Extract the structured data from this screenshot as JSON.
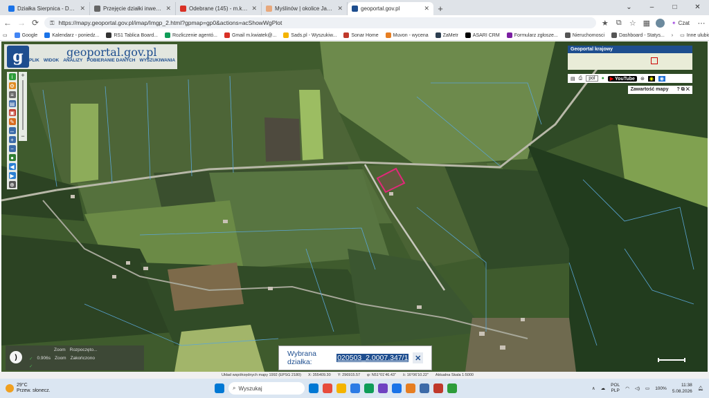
{
  "browser": {
    "tabs": [
      {
        "title": "Działka Sierpnica - Dysk Google",
        "color": "#1a73e8",
        "active": false
      },
      {
        "title": "Przejęcie działki inwestycyjnej",
        "color": "#666666",
        "active": false
      },
      {
        "title": "Odebrane (145) - m.kwiatek@mu",
        "color": "#d93025",
        "active": false
      },
      {
        "title": "Myślinów | okolice Jawora - Muvo",
        "color": "#e8a87c",
        "active": false
      },
      {
        "title": "geoportal.gov.pl",
        "color": "#1e4e8f",
        "active": true
      }
    ],
    "new_tab": "+",
    "window_controls": [
      "⌄",
      "–",
      "□",
      "✕"
    ],
    "url": "https://mapy.geoportal.gov.pl/imap/Imgp_2.html?gpmap=gp0&actions=acShowWgPlot",
    "chat_label": "Czat",
    "bookmarks": [
      {
        "label": "Google",
        "color": "#4285f4"
      },
      {
        "label": "Kalendarz - poniedz...",
        "color": "#1a73e8"
      },
      {
        "label": "RS1 Tablica Board...",
        "color": "#333333"
      },
      {
        "label": "Rozliczenie agentó...",
        "color": "#0f9d58"
      },
      {
        "label": "Gmail m.kwiatek@...",
        "color": "#d93025"
      },
      {
        "label": "Sads.pl - Wyszukiw...",
        "color": "#f4b400"
      },
      {
        "label": "Sonar Home",
        "color": "#c0392b"
      },
      {
        "label": "Muvon - wycena",
        "color": "#e67e22"
      },
      {
        "label": "ZaMetr",
        "color": "#2c3e50"
      },
      {
        "label": "ASARI CRM",
        "color": "#000000"
      },
      {
        "label": "Formularz zgłosze...",
        "color": "#7b1fa2"
      },
      {
        "label": "Nieruchomosci",
        "color": "#555555"
      },
      {
        "label": "Dashboard - Statys...",
        "color": "#555555"
      }
    ],
    "bookmarks_more": "›",
    "other_bookmarks": "Inne ulubione"
  },
  "geoportal": {
    "logo_letter": "g",
    "site_name": "geoportal.gov.pl",
    "menu": [
      "PLIK",
      "WIDOK",
      "ANALIZY",
      "POBIERANIE DANYCH",
      "WYSZUKIWANIA"
    ],
    "tool_icons": [
      {
        "name": "info-icon",
        "glyph": "i",
        "color": "#2e9d3a"
      },
      {
        "name": "settings-icon",
        "glyph": "⚙",
        "color": "#e08a1e"
      },
      {
        "name": "layers-icon",
        "glyph": "≡",
        "color": "#6a6a6a"
      },
      {
        "name": "print-icon",
        "glyph": "▤",
        "color": "#3c6aa8"
      },
      {
        "name": "plot-icon",
        "glyph": "▣",
        "color": "#c0392b"
      },
      {
        "name": "draw-icon",
        "glyph": "✎",
        "color": "#d86a1e"
      },
      {
        "name": "measure-icon",
        "glyph": "↔",
        "color": "#3c6aa8"
      },
      {
        "name": "zoom-in-icon",
        "glyph": "+",
        "color": "#3c6aa8"
      },
      {
        "name": "zoom-out-icon",
        "glyph": "−",
        "color": "#3c6aa8"
      },
      {
        "name": "globe-icon",
        "glyph": "●",
        "color": "#2e7d32"
      },
      {
        "name": "back-arrow-icon",
        "glyph": "◀",
        "color": "#2a7fd4"
      },
      {
        "name": "forward-arrow-icon",
        "glyph": "▶",
        "color": "#2a7fd4"
      },
      {
        "name": "crosshair-icon",
        "glyph": "⊕",
        "color": "#555555"
      }
    ],
    "zoom_plus": "+",
    "zoom_minus": "−",
    "overview_title": "Geoportal krajowy",
    "lang_select": "pol",
    "youtube_label": "YouTube",
    "map_contents": "Zawartość mapy",
    "map_contents_controls": [
      "?",
      "⧉",
      "✕"
    ],
    "zoom_log": {
      "header": [
        "Zoom",
        "Rozpoczęto..."
      ],
      "row": [
        "0.906s",
        "Zoom",
        "Zakończono"
      ]
    },
    "selected_plot_label": "Wybrana działka:",
    "selected_plot_value": "020503_2.0007.347/1",
    "close": "✕",
    "status": {
      "crs": "Układ współrzędnych mapy 1992 (EPSG 2180)",
      "x": "X: 355409.30",
      "y": "Y: 296915.57",
      "lat": "φ: N51°01'46.43\"",
      "lon": "λ: 16°06'10.22\"",
      "scale": "Aktualna Skala 1:5000"
    }
  },
  "taskbar": {
    "weather_temp": "29°C",
    "weather_desc": "Przew. słonecz.",
    "search_placeholder": "Wyszukaj",
    "app_colors": [
      "#0078d4",
      "#e74c3c",
      "#f4b400",
      "#2c7be5",
      "#0f9d58",
      "#6f42c1",
      "#1a73e8",
      "#e67e22",
      "#3c6aa8",
      "#c0392b",
      "#2e9d3a"
    ],
    "lang": "POL",
    "lang2": "PLP",
    "battery": "100%",
    "time": "11:38",
    "date": "5.08.2026"
  }
}
